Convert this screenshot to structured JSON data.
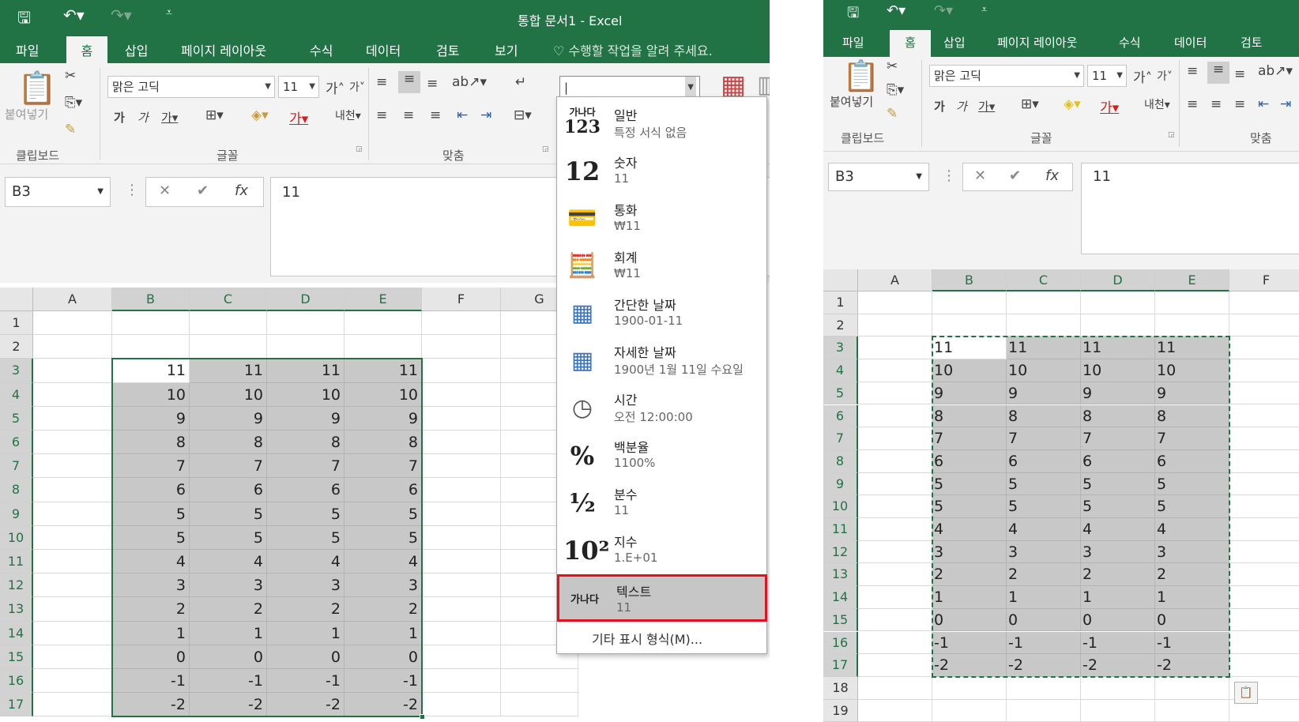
{
  "colors": {
    "accent": "#217346",
    "selection": "#c8c8c8",
    "highlight_border": "#e3101f"
  },
  "left": {
    "title": "통합 문서1 - Excel",
    "tabs": [
      "파일",
      "홈",
      "삽입",
      "페이지 레이아웃",
      "수식",
      "데이터",
      "검토",
      "보기"
    ],
    "active_tab": "홈",
    "tell_me": "수행할 작업을 알려 주세요.",
    "ribbon": {
      "paste_label": "붙여넣기",
      "font_name": "맑은 고딕",
      "font_size": "11",
      "groups": [
        "클립보드",
        "글꼴",
        "맞춤"
      ],
      "number_format_value": ""
    },
    "name_box": "B3",
    "formula_value": "11",
    "columns": [
      "A",
      "B",
      "C",
      "D",
      "E",
      "F",
      "G"
    ],
    "rows": [
      "1",
      "2",
      "3",
      "4",
      "5",
      "6",
      "7",
      "8",
      "9",
      "10",
      "11",
      "12",
      "13",
      "14",
      "15",
      "16",
      "17"
    ],
    "data": [
      [
        "11",
        "11",
        "11",
        "11"
      ],
      [
        "10",
        "10",
        "10",
        "10"
      ],
      [
        "9",
        "9",
        "9",
        "9"
      ],
      [
        "8",
        "8",
        "8",
        "8"
      ],
      [
        "7",
        "7",
        "7",
        "7"
      ],
      [
        "6",
        "6",
        "6",
        "6"
      ],
      [
        "5",
        "5",
        "5",
        "5"
      ],
      [
        "5",
        "5",
        "5",
        "5"
      ],
      [
        "4",
        "4",
        "4",
        "4"
      ],
      [
        "3",
        "3",
        "3",
        "3"
      ],
      [
        "2",
        "2",
        "2",
        "2"
      ],
      [
        "1",
        "1",
        "1",
        "1"
      ],
      [
        "0",
        "0",
        "0",
        "0"
      ],
      [
        "-1",
        "-1",
        "-1",
        "-1"
      ],
      [
        "-2",
        "-2",
        "-2",
        "-2"
      ]
    ],
    "format_menu": {
      "items": [
        {
          "icon": "general-format-icon",
          "icon_top": "가나다",
          "icon_bottom": "123",
          "name": "일반",
          "sample": "특정 서식 없음"
        },
        {
          "icon": "number-format-icon",
          "icon_text": "12",
          "name": "숫자",
          "sample": "11"
        },
        {
          "icon": "currency-format-icon",
          "name": "통화",
          "sample": "₩11"
        },
        {
          "icon": "accounting-format-icon",
          "name": "회계",
          "sample": " ₩11"
        },
        {
          "icon": "short-date-calendar-icon",
          "name": "간단한 날짜",
          "sample": "1900-01-11"
        },
        {
          "icon": "long-date-calendar-icon",
          "name": "자세한 날짜",
          "sample": "1900년 1월 11일 수요일"
        },
        {
          "icon": "clock-icon",
          "name": "시간",
          "sample": "오전 12:00:00"
        },
        {
          "icon": "percent-icon",
          "icon_text": "%",
          "name": "백분율",
          "sample": "1100%"
        },
        {
          "icon": "fraction-icon",
          "icon_text": "½",
          "name": "분수",
          "sample": "11"
        },
        {
          "icon": "scientific-icon",
          "icon_text": "10²",
          "name": "지수",
          "sample": "1.E+01"
        },
        {
          "icon": "text-format-icon",
          "icon_text": "가나다",
          "name": "텍스트",
          "sample": "11",
          "highlighted": true
        }
      ],
      "more": "기타 표시 형식(M)..."
    }
  },
  "right": {
    "tabs": [
      "파일",
      "홈",
      "삽입",
      "페이지 레이아웃",
      "수식",
      "데이터",
      "검토"
    ],
    "active_tab": "홈",
    "ribbon": {
      "paste_label": "붙여넣기",
      "font_name": "맑은 고딕",
      "font_size": "11",
      "groups": [
        "클립보드",
        "글꼴",
        "맞춤"
      ]
    },
    "name_box": "B3",
    "formula_value": "11",
    "columns": [
      "A",
      "B",
      "C",
      "D",
      "E",
      "F"
    ],
    "rows": [
      "1",
      "2",
      "3",
      "4",
      "5",
      "6",
      "7",
      "8",
      "9",
      "10",
      "11",
      "12",
      "13",
      "14",
      "15",
      "16",
      "17",
      "18",
      "19"
    ],
    "data": [
      [
        "11",
        "11",
        "11",
        "11"
      ],
      [
        "10",
        "10",
        "10",
        "10"
      ],
      [
        "9",
        "9",
        "9",
        "9"
      ],
      [
        "8",
        "8",
        "8",
        "8"
      ],
      [
        "7",
        "7",
        "7",
        "7"
      ],
      [
        "6",
        "6",
        "6",
        "6"
      ],
      [
        "5",
        "5",
        "5",
        "5"
      ],
      [
        "5",
        "5",
        "5",
        "5"
      ],
      [
        "4",
        "4",
        "4",
        "4"
      ],
      [
        "3",
        "3",
        "3",
        "3"
      ],
      [
        "2",
        "2",
        "2",
        "2"
      ],
      [
        "1",
        "1",
        "1",
        "1"
      ],
      [
        "0",
        "0",
        "0",
        "0"
      ],
      [
        "-1",
        "-1",
        "-1",
        "-1"
      ],
      [
        "-2",
        "-2",
        "-2",
        "-2"
      ]
    ]
  }
}
